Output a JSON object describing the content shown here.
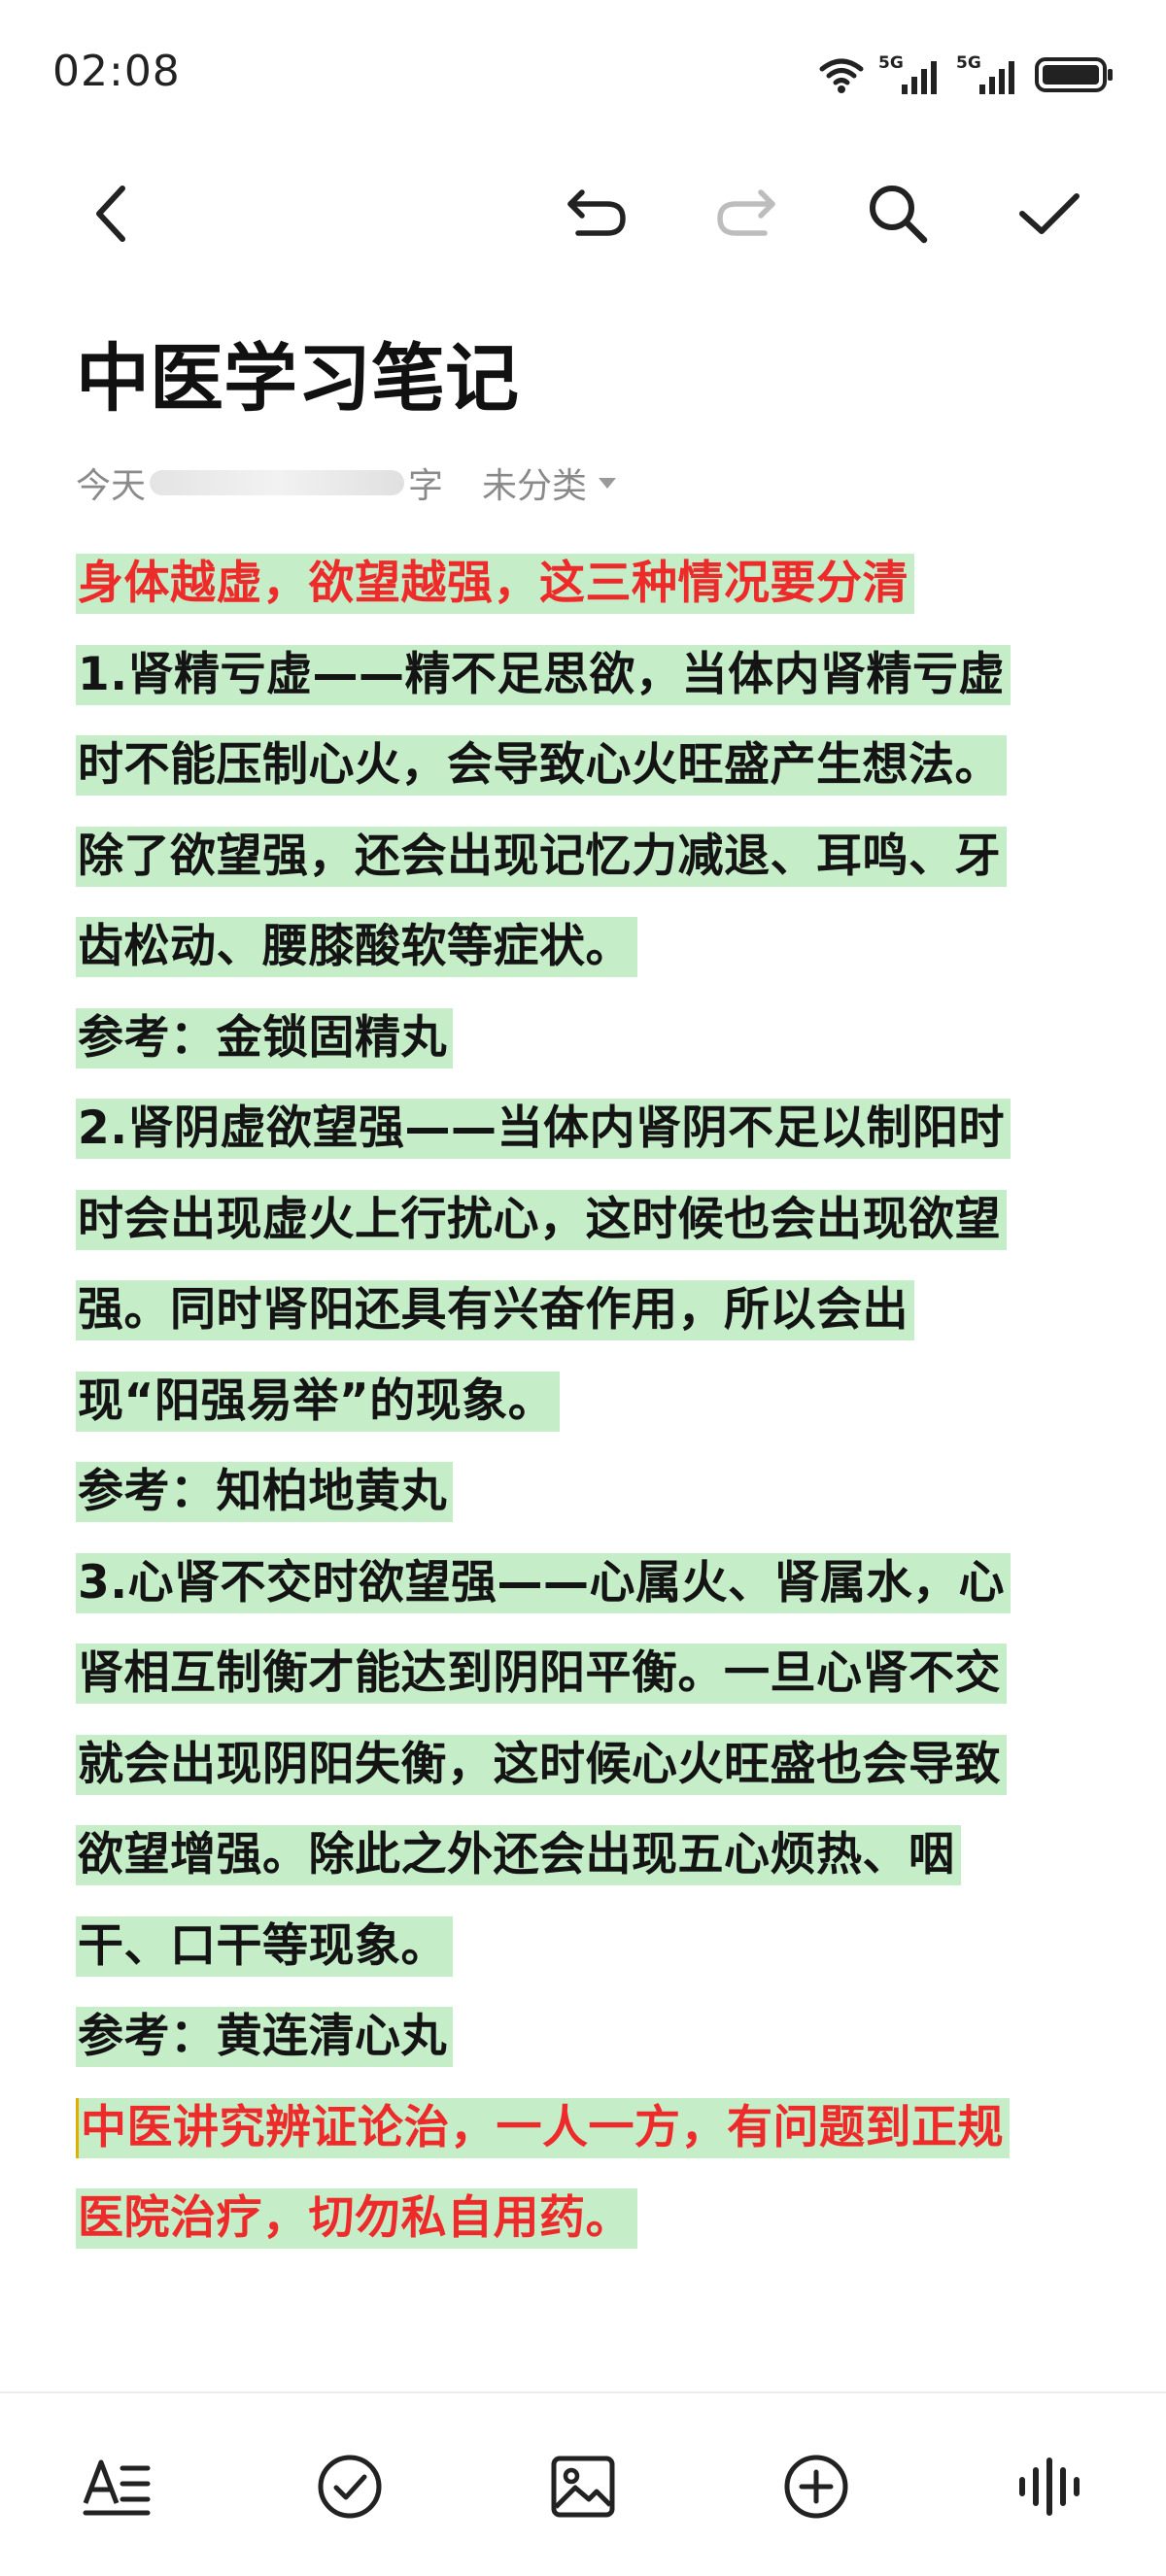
{
  "status_bar": {
    "time": "02:08",
    "icons": [
      "wifi-icon",
      "signal-5g-icon",
      "signal-5g-icon",
      "battery-icon"
    ],
    "network_label_1": "5G",
    "network_label_2": "5G"
  },
  "toolbar": {
    "back": "back-icon",
    "undo": "undo-icon",
    "redo": "redo-icon",
    "search": "search-icon",
    "done": "check-icon"
  },
  "note": {
    "title": "中医学习笔记",
    "meta_prefix": "今天",
    "meta_suffix": "字",
    "category": "未分类"
  },
  "lines": [
    {
      "text": "身体越虚，欲望越强，这三种情况要分清",
      "style": "red"
    },
    {
      "text": "1.肾精亏虚——精不足思欲，当体内肾精亏虚",
      "style": "normal"
    },
    {
      "text": "时不能压制心火，会导致心火旺盛产生想法。",
      "style": "normal"
    },
    {
      "text": "除了欲望强，还会出现记忆力减退、耳鸣、牙",
      "style": "normal"
    },
    {
      "text": "齿松动、腰膝酸软等症状。",
      "style": "normal"
    },
    {
      "text": "参考：金锁固精丸",
      "style": "normal"
    },
    {
      "text": "2.肾阴虚欲望强——当体内肾阴不足以制阳时",
      "style": "normal"
    },
    {
      "text": "时会出现虚火上行扰心，这时候也会出现欲望",
      "style": "normal"
    },
    {
      "text": "强。同时肾阳还具有兴奋作用，所以会出",
      "style": "normal"
    },
    {
      "text": "现“阳强易举”的现象。",
      "style": "normal"
    },
    {
      "text": "参考：知柏地黄丸",
      "style": "normal"
    },
    {
      "text": "3.心肾不交时欲望强——心属火、肾属水，心",
      "style": "normal"
    },
    {
      "text": "肾相互制衡才能达到阴阳平衡。一旦心肾不交",
      "style": "normal"
    },
    {
      "text": "就会出现阴阳失衡，这时候心火旺盛也会导致",
      "style": "normal"
    },
    {
      "text": "欲望增强。除此之外还会出现五心烦热、咽",
      "style": "normal"
    },
    {
      "text": "干、口干等现象。",
      "style": "normal"
    },
    {
      "text": "参考：黄连清心丸",
      "style": "normal"
    },
    {
      "text": "中医讲究辨证论治，一人一方，有问题到正规",
      "style": "red caret"
    },
    {
      "text": "医院治疗，切勿私自用药。",
      "style": "red"
    }
  ],
  "bottom_bar": {
    "items": [
      "text-format-icon",
      "checklist-icon",
      "image-icon",
      "add-icon",
      "voice-icon"
    ]
  },
  "colors": {
    "highlight": "#c4edc8",
    "red_text": "#ee2b2b",
    "body_text": "#141414",
    "meta_text": "#8a8a8a"
  }
}
